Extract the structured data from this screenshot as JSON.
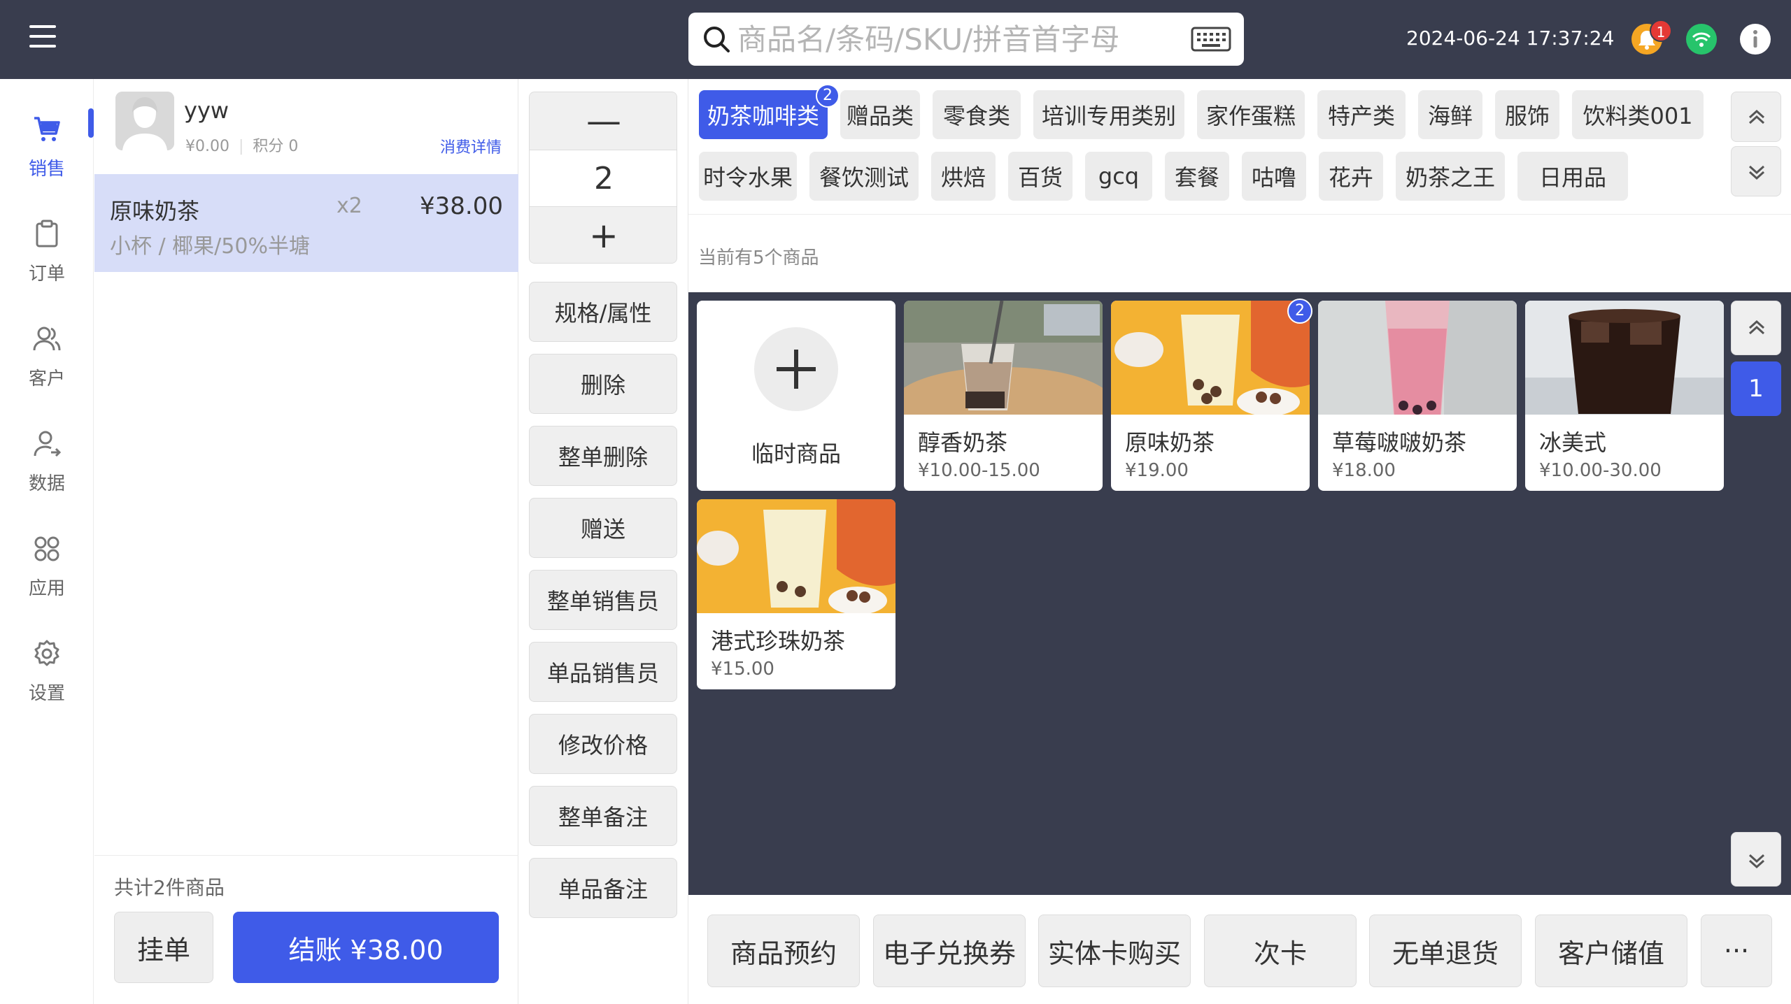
{
  "search": {
    "placeholder": "商品名/条码/SKU/拼音首字母"
  },
  "datetime": "2024-06-24 17:37:24",
  "notifications": {
    "count": "1"
  },
  "nav": [
    {
      "label": "销售",
      "icon": "cart-icon",
      "active": true
    },
    {
      "label": "订单",
      "icon": "clipboard-icon"
    },
    {
      "label": "客户",
      "icon": "users-icon"
    },
    {
      "label": "数据",
      "icon": "user-data-icon"
    },
    {
      "label": "应用",
      "icon": "apps-icon"
    },
    {
      "label": "设置",
      "icon": "gear-icon"
    }
  ],
  "customer": {
    "name": "yyw",
    "balance": "¥0.00",
    "points": "积分 0",
    "detail_link": "消费详情"
  },
  "cart": {
    "items": [
      {
        "name": "原味奶茶",
        "qty": "x2",
        "price": "¥38.00",
        "spec": "小杯 / 椰果/50%半塘"
      }
    ],
    "total_text": "共计2件商品",
    "hold_label": "挂单",
    "pay_label": "结账 ¥38.00"
  },
  "actions": {
    "minus": "—",
    "qty": "2",
    "plus": "+",
    "buttons": [
      "规格/属性",
      "删除",
      "整单删除",
      "赠送",
      "整单销售员",
      "单品销售员",
      "修改价格",
      "整单备注",
      "单品备注"
    ]
  },
  "categories": {
    "row1": [
      "奶茶咖啡类",
      "赠品类",
      "零食类",
      "培训专用类别",
      "家作蛋糕",
      "特产类",
      "海鲜",
      "服饰",
      "饮料类001"
    ],
    "row2": [
      "时令水果",
      "餐饮测试",
      "烘焙",
      "百货",
      "gcq",
      "套餐",
      "咕噜",
      "花卉",
      "奶茶之王",
      "日用品"
    ],
    "active_badge": "2"
  },
  "product_count_text": "当前有5个商品",
  "temp_product": {
    "label": "临时商品"
  },
  "products": [
    {
      "name": "醇香奶茶",
      "price": "¥10.00-15.00"
    },
    {
      "name": "原味奶茶",
      "price": "¥19.00",
      "badge": "2"
    },
    {
      "name": "草莓啵啵奶茶",
      "price": "¥18.00"
    },
    {
      "name": "冰美式",
      "price": "¥10.00-30.00"
    },
    {
      "name": "港式珍珠奶茶",
      "price": "¥15.00"
    }
  ],
  "pagination": {
    "current": "1"
  },
  "bottom": {
    "buttons": [
      "商品预约",
      "电子兑换券",
      "实体卡购买",
      "次卡",
      "无单退货",
      "客户储值"
    ],
    "more_label": "···"
  },
  "colors": {
    "accent": "#3f5be8",
    "topbar": "#393d4e",
    "bell": "#f5a623",
    "wifi": "#27c46b",
    "badge": "#e53935"
  }
}
